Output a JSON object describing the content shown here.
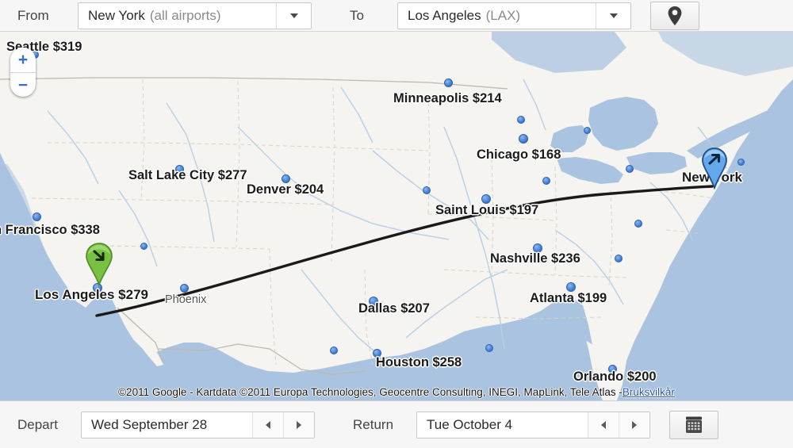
{
  "toolbar": {
    "from_label": "From",
    "from_value_main": "New York",
    "from_value_sub": "(all airports)",
    "to_label": "To",
    "to_value_main": "Los Angeles",
    "to_value_sub": "(LAX)",
    "dropdown_icon": "chevron-down-icon",
    "locate_button_icon": "map-pin-icon"
  },
  "bottombar": {
    "depart_label": "Depart",
    "depart_value": "Wed September 28",
    "return_label": "Return",
    "return_value": "Tue October 4",
    "prev_icon": "triangle-left-icon",
    "next_icon": "triangle-right-icon",
    "calendar_button_icon": "calendar-icon"
  },
  "map": {
    "zoom_in_label": "+",
    "zoom_out_label": "−",
    "attribution_text": "©2011 Google - Kartdata ©2011 Europa Technologies, Geocentre Consulting, INEGI, MapLink, Tele Atlas - ",
    "attribution_link": "Bruksvilkår",
    "origin_marker": {
      "label": "New York",
      "icon": "depart-arrow-pin",
      "color": "#66aaf0"
    },
    "destination_marker": {
      "label": "Los Angeles $279",
      "icon": "arrive-arrow-pin",
      "color": "#7ec64a"
    },
    "colors": {
      "land": "#f5f4f0",
      "water": "#a9c3e0",
      "route_line": "#222222",
      "dot_fill": "#4a84d6"
    },
    "price_labels": [
      {
        "city": "Seattle",
        "price": "$319",
        "text": "Seattle $319"
      },
      {
        "city": "San Francisco",
        "price": "$338",
        "text": "n Francisco $338"
      },
      {
        "city": "Salt Lake City",
        "price": "$277",
        "text": "Salt Lake City $277"
      },
      {
        "city": "Denver",
        "price": "$204",
        "text": "Denver $204"
      },
      {
        "city": "Minneapolis",
        "price": "$214",
        "text": "Minneapolis $214"
      },
      {
        "city": "Chicago",
        "price": "$168",
        "text": "Chicago $168"
      },
      {
        "city": "Saint Louis",
        "price": "$197",
        "text": "Saint Louis $197"
      },
      {
        "city": "Nashville",
        "price": "$236",
        "text": "Nashville $236"
      },
      {
        "city": "Atlanta",
        "price": "$199",
        "text": "Atlanta $199"
      },
      {
        "city": "Dallas",
        "price": "$207",
        "text": "Dallas $207"
      },
      {
        "city": "Houston",
        "price": "$258",
        "text": "Houston $258"
      },
      {
        "city": "Orlando",
        "price": "$200",
        "text": "Orlando $200"
      },
      {
        "city": "Los Angeles",
        "price": "$279",
        "text": "Los Angeles $279"
      },
      {
        "city": "Phoenix",
        "price": "",
        "text": "Phoenix"
      },
      {
        "city": "New York",
        "price": "",
        "text": "New York"
      }
    ]
  }
}
